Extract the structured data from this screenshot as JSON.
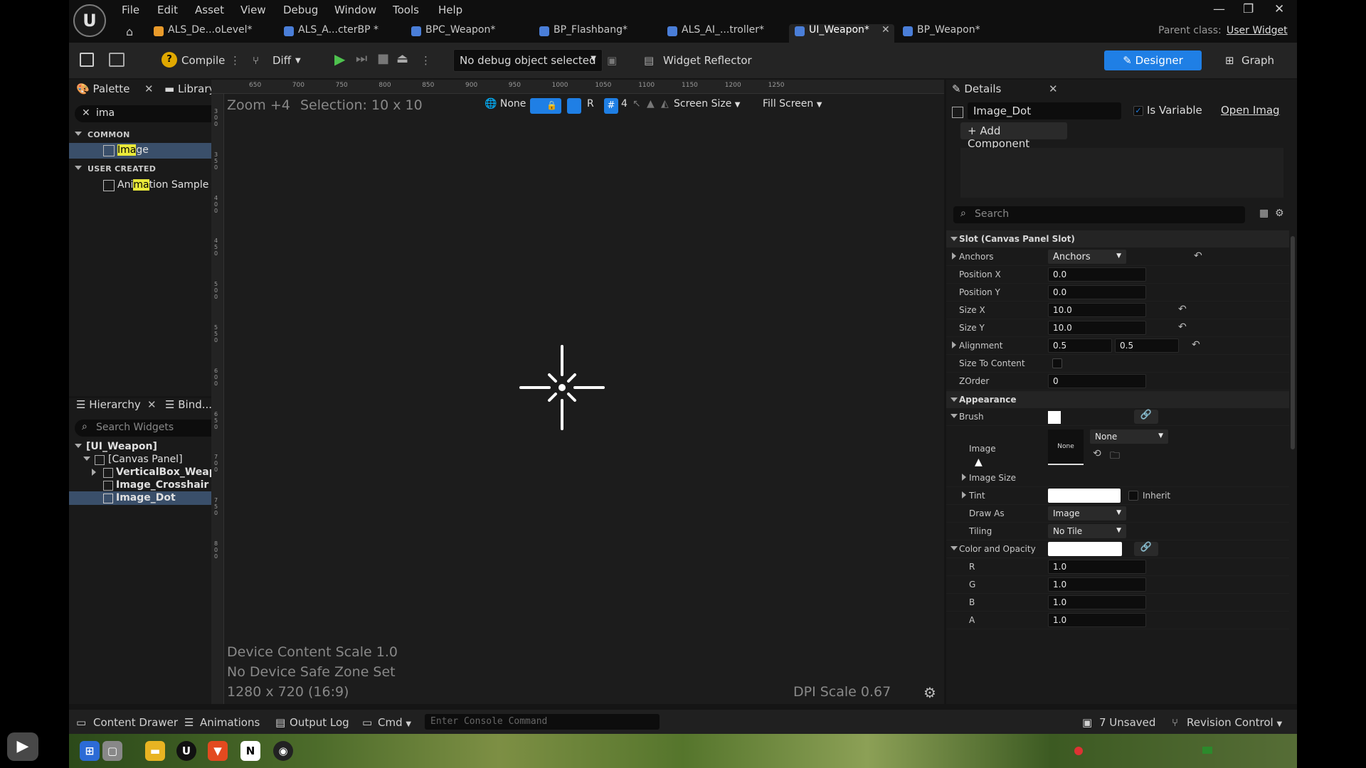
{
  "menu": [
    "File",
    "Edit",
    "Asset",
    "View",
    "Debug",
    "Window",
    "Tools",
    "Help"
  ],
  "tabs": [
    {
      "label": "ALS_De...oLevel*",
      "color": "#e89a2a"
    },
    {
      "label": "ALS_A...cterBP  *",
      "color": "#4a7ed8"
    },
    {
      "label": "BPC_Weapon*",
      "color": "#4a7ed8"
    },
    {
      "label": "BP_Flashbang*",
      "color": "#4a7ed8"
    },
    {
      "label": "ALS_AI_...troller*",
      "color": "#4a7ed8"
    },
    {
      "label": "UI_Weapon*",
      "color": "#4a7ed8"
    },
    {
      "label": "BP_Weapon*",
      "color": "#4a7ed8"
    }
  ],
  "parent_class": {
    "label": "Parent class:",
    "value": "User Widget"
  },
  "toolbar": {
    "compile": "Compile",
    "diff": "Diff",
    "debug_object": "No debug object selected",
    "widget_reflector": "Widget Reflector",
    "designer": "Designer",
    "graph": "Graph"
  },
  "palette": {
    "tab_palette": "Palette",
    "tab_library": "Library",
    "search_value": "ima",
    "section_common": "COMMON",
    "item_image_pre": "",
    "item_image_hl": "Ima",
    "item_image_post": "ge",
    "section_user": "USER CREATED",
    "item_anim_pre": "Ani",
    "item_anim_hl": "ma",
    "item_anim_post": "tion Sample UI"
  },
  "hierarchy": {
    "tab_hierarchy": "Hierarchy",
    "tab_bind": "Bind...ets",
    "search_placeholder": "Search Widgets",
    "items": [
      "[UI_Weapon]",
      "[Canvas Panel]",
      "VerticalBox_WeaponIn",
      "Image_Crosshair",
      "Image_Dot"
    ]
  },
  "viewport": {
    "zoom": "Zoom +4",
    "selection": "Selection: 10 x 10",
    "none_btn": "None",
    "r_btn": "R",
    "grid_num": "4",
    "screen_size": "Screen Size",
    "fill_screen": "Fill Screen",
    "ruler_h": [
      "650",
      "700",
      "750",
      "800",
      "850",
      "900",
      "950",
      "1000",
      "1050",
      "1100",
      "1150",
      "1200",
      "1250"
    ],
    "ruler_v": [
      "300",
      "350",
      "400",
      "450",
      "500",
      "550",
      "600",
      "650",
      "700",
      "750",
      "800"
    ],
    "device_content_scale": "Device Content Scale 1.0",
    "safe_zone": "No Device Safe Zone Set",
    "resolution": "1280 x 720 (16:9)",
    "dpi_scale": "DPI Scale 0.67"
  },
  "details": {
    "title": "Details",
    "name_value": "Image_Dot",
    "is_variable": "Is Variable",
    "open_image": "Open Imag",
    "add_component": "+ Add Component",
    "search_placeholder": "Search",
    "slot_header": "Slot (Canvas Panel Slot)",
    "anchors_label": "Anchors",
    "anchors_value": "Anchors",
    "position_x_label": "Position X",
    "position_x": "0.0",
    "position_y_label": "Position Y",
    "position_y": "0.0",
    "size_x_label": "Size X",
    "size_x": "10.0",
    "size_y_label": "Size Y",
    "size_y": "10.0",
    "alignment_label": "Alignment",
    "alignment_x": "0.5",
    "alignment_y": "0.5",
    "size_to_content_label": "Size To Content",
    "zorder_label": "ZOrder",
    "zorder": "0",
    "appearance_header": "Appearance",
    "brush_label": "Brush",
    "image_label": "Image",
    "image_thumb": "None",
    "image_select": "None",
    "image_size_label": "Image Size",
    "tint_label": "Tint",
    "inherit_label": "Inherit",
    "draw_as_label": "Draw As",
    "draw_as": "Image",
    "tiling_label": "Tiling",
    "tiling": "No Tile",
    "color_opacity_label": "Color and Opacity",
    "r_label": "R",
    "r": "1.0",
    "g_label": "G",
    "g": "1.0",
    "b_label": "B",
    "b": "1.0",
    "a_label": "A",
    "a": "1.0"
  },
  "statusbar": {
    "content_drawer": "Content Drawer",
    "animations": "Animations",
    "output_log": "Output Log",
    "cmd": "Cmd",
    "console_placeholder": "Enter Console Command",
    "unsaved": "7 Unsaved",
    "revision_control": "Revision Control"
  },
  "colors": {
    "accent": "#1f7fe5",
    "highlight": "#e9e93a",
    "selected_row": "#3a4f6a"
  }
}
